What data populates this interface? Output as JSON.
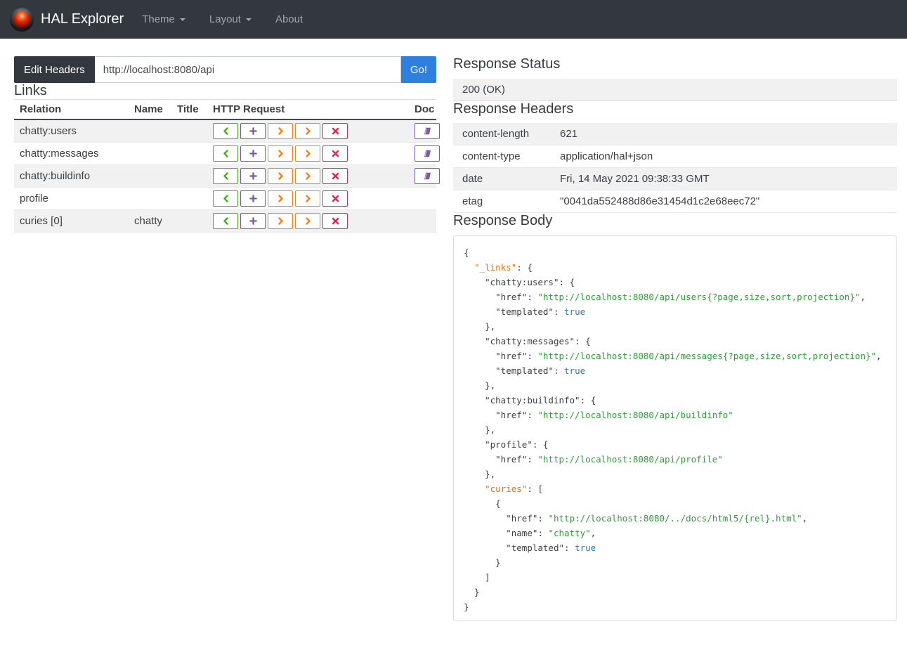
{
  "colors": {
    "navbar_bg": "#33383e",
    "primary_blue": "#2f80de"
  },
  "navbar": {
    "brand": "HAL Explorer",
    "logo_icon": "hal-9000-eye-icon",
    "menus": [
      {
        "label": "Theme",
        "caret": true
      },
      {
        "label": "Layout",
        "caret": true
      },
      {
        "label": "About",
        "caret": false
      }
    ]
  },
  "request_bar": {
    "edit_headers_label": "Edit Headers",
    "url_value": "http://localhost:8080/api",
    "go_label": "Go!"
  },
  "links": {
    "title": "Links",
    "columns": [
      "Relation",
      "Name",
      "Title",
      "HTTP Request",
      "Doc"
    ],
    "buttons": [
      {
        "name": "get",
        "icon": "chevron-left-icon",
        "color": "#40b412"
      },
      {
        "name": "post",
        "icon": "plus-icon",
        "color": "#8156a8"
      },
      {
        "name": "put",
        "icon": "chevron-right-icon",
        "color": "#fd7e14"
      },
      {
        "name": "patch",
        "icon": "chevron-right-icon",
        "color": "#fd7e14"
      },
      {
        "name": "delete",
        "icon": "x-icon",
        "color": "#e9214e"
      }
    ],
    "doc_icon": "book-icon",
    "doc_color": "#8156a8",
    "rows": [
      {
        "relation": "chatty:users",
        "name": "",
        "title": "",
        "doc": true
      },
      {
        "relation": "chatty:messages",
        "name": "",
        "title": "",
        "doc": true
      },
      {
        "relation": "chatty:buildinfo",
        "name": "",
        "title": "",
        "doc": true
      },
      {
        "relation": "profile",
        "name": "",
        "title": "",
        "doc": false
      },
      {
        "relation": "curies [0]",
        "name": "chatty",
        "title": "",
        "doc": false
      }
    ]
  },
  "response_status": {
    "title": "Response Status",
    "value": "200 (OK)"
  },
  "response_headers": {
    "title": "Response Headers",
    "rows": [
      {
        "key": "content-length",
        "value": "621"
      },
      {
        "key": "content-type",
        "value": "application/hal+json"
      },
      {
        "key": "date",
        "value": "Fri, 14 May 2021 09:38:33 GMT"
      },
      {
        "key": "etag",
        "value": "\"0041da552488d86e31454d1c2e68eec72\""
      }
    ]
  },
  "response_body": {
    "title": "Response Body",
    "colors": {
      "default": "#3b4045",
      "special_key": "#e8730e",
      "string": "#2e9e38",
      "boolean": "#2b7bba"
    },
    "lines": [
      [
        [
          "p",
          "{"
        ]
      ],
      [
        [
          "p",
          "  "
        ],
        [
          "x",
          "\"_links\""
        ],
        [
          "p",
          ": {"
        ]
      ],
      [
        [
          "p",
          "    "
        ],
        [
          "k",
          "\"chatty:users\""
        ],
        [
          "p",
          ": {"
        ]
      ],
      [
        [
          "p",
          "      "
        ],
        [
          "k",
          "\"href\""
        ],
        [
          "p",
          ": "
        ],
        [
          "s",
          "\"http://localhost:8080/api/users{?page,size,sort,projection}\""
        ],
        [
          "p",
          ","
        ]
      ],
      [
        [
          "p",
          "      "
        ],
        [
          "k",
          "\"templated\""
        ],
        [
          "p",
          ": "
        ],
        [
          "b",
          "true"
        ]
      ],
      [
        [
          "p",
          "    },"
        ]
      ],
      [
        [
          "p",
          "    "
        ],
        [
          "k",
          "\"chatty:messages\""
        ],
        [
          "p",
          ": {"
        ]
      ],
      [
        [
          "p",
          "      "
        ],
        [
          "k",
          "\"href\""
        ],
        [
          "p",
          ": "
        ],
        [
          "s",
          "\"http://localhost:8080/api/messages{?page,size,sort,projection}\""
        ],
        [
          "p",
          ","
        ]
      ],
      [
        [
          "p",
          "      "
        ],
        [
          "k",
          "\"templated\""
        ],
        [
          "p",
          ": "
        ],
        [
          "b",
          "true"
        ]
      ],
      [
        [
          "p",
          "    },"
        ]
      ],
      [
        [
          "p",
          "    "
        ],
        [
          "k",
          "\"chatty:buildinfo\""
        ],
        [
          "p",
          ": {"
        ]
      ],
      [
        [
          "p",
          "      "
        ],
        [
          "k",
          "\"href\""
        ],
        [
          "p",
          ": "
        ],
        [
          "s",
          "\"http://localhost:8080/api/buildinfo\""
        ]
      ],
      [
        [
          "p",
          "    },"
        ]
      ],
      [
        [
          "p",
          "    "
        ],
        [
          "k",
          "\"profile\""
        ],
        [
          "p",
          ": {"
        ]
      ],
      [
        [
          "p",
          "      "
        ],
        [
          "k",
          "\"href\""
        ],
        [
          "p",
          ": "
        ],
        [
          "s",
          "\"http://localhost:8080/api/profile\""
        ]
      ],
      [
        [
          "p",
          "    },"
        ]
      ],
      [
        [
          "p",
          "    "
        ],
        [
          "x",
          "\"curies\""
        ],
        [
          "p",
          ": ["
        ]
      ],
      [
        [
          "p",
          "      {"
        ]
      ],
      [
        [
          "p",
          "        "
        ],
        [
          "k",
          "\"href\""
        ],
        [
          "p",
          ": "
        ],
        [
          "s",
          "\"http://localhost:8080/../docs/html5/{rel}.html\""
        ],
        [
          "p",
          ","
        ]
      ],
      [
        [
          "p",
          "        "
        ],
        [
          "k",
          "\"name\""
        ],
        [
          "p",
          ": "
        ],
        [
          "s",
          "\"chatty\""
        ],
        [
          "p",
          ","
        ]
      ],
      [
        [
          "p",
          "        "
        ],
        [
          "k",
          "\"templated\""
        ],
        [
          "p",
          ": "
        ],
        [
          "b",
          "true"
        ]
      ],
      [
        [
          "p",
          "      }"
        ]
      ],
      [
        [
          "p",
          "    ]"
        ]
      ],
      [
        [
          "p",
          "  }"
        ]
      ],
      [
        [
          "p",
          "}"
        ]
      ]
    ]
  }
}
